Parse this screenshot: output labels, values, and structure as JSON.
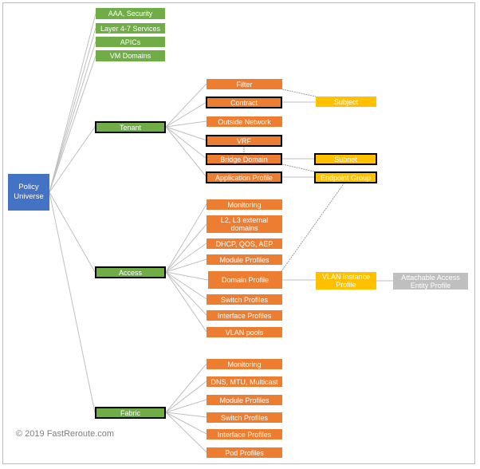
{
  "root": {
    "label": "Policy\nUniverse",
    "color": "#4472c4"
  },
  "top_level_items": [
    {
      "label": "AAA, Security"
    },
    {
      "label": "Layer 4-7 Services"
    },
    {
      "label": "APICs"
    },
    {
      "label": "VM Domains"
    }
  ],
  "tenant": {
    "label": "Tenant",
    "children": [
      {
        "label": "Filter"
      },
      {
        "label": "Contract"
      },
      {
        "label": "Outside Network"
      },
      {
        "label": "VRF"
      },
      {
        "label": "Bridge Domain"
      },
      {
        "label": "Application Profile"
      }
    ],
    "related": [
      {
        "label": "Subject"
      },
      {
        "label": "Subnet"
      },
      {
        "label": "Endpoint Group"
      }
    ]
  },
  "access": {
    "label": "Access",
    "children": [
      {
        "label": "Monitoring"
      },
      {
        "label": "L2, L3 external\ndomains"
      },
      {
        "label": "DHCP, QOS, AEP"
      },
      {
        "label": "Module Profiles"
      },
      {
        "label": "Domain Profile"
      },
      {
        "label": "Switch Profiles"
      },
      {
        "label": "Interface Profiles"
      },
      {
        "label": "VLAN pools"
      }
    ],
    "related": [
      {
        "label": "VLAN Instance\nProfile"
      },
      {
        "label": "Attachable Access\nEntity Profile"
      }
    ]
  },
  "fabric": {
    "label": "Fabric",
    "children": [
      {
        "label": "Monitoring"
      },
      {
        "label": "DNS, MTU, Multicast"
      },
      {
        "label": "Module Profiles"
      },
      {
        "label": "Switch Profiles"
      },
      {
        "label": "Interface Profiles"
      },
      {
        "label": "Pod Profiles"
      }
    ]
  },
  "colors": {
    "root": "#4472c4",
    "level1": "#70ad47",
    "level2": "#ed7d31",
    "level3": "#ffc000",
    "level4": "#bfbfbf",
    "connector": "#bfbfbf",
    "frame": "#9dc3e6"
  },
  "copyright": "© 2019 FastReroute.com"
}
